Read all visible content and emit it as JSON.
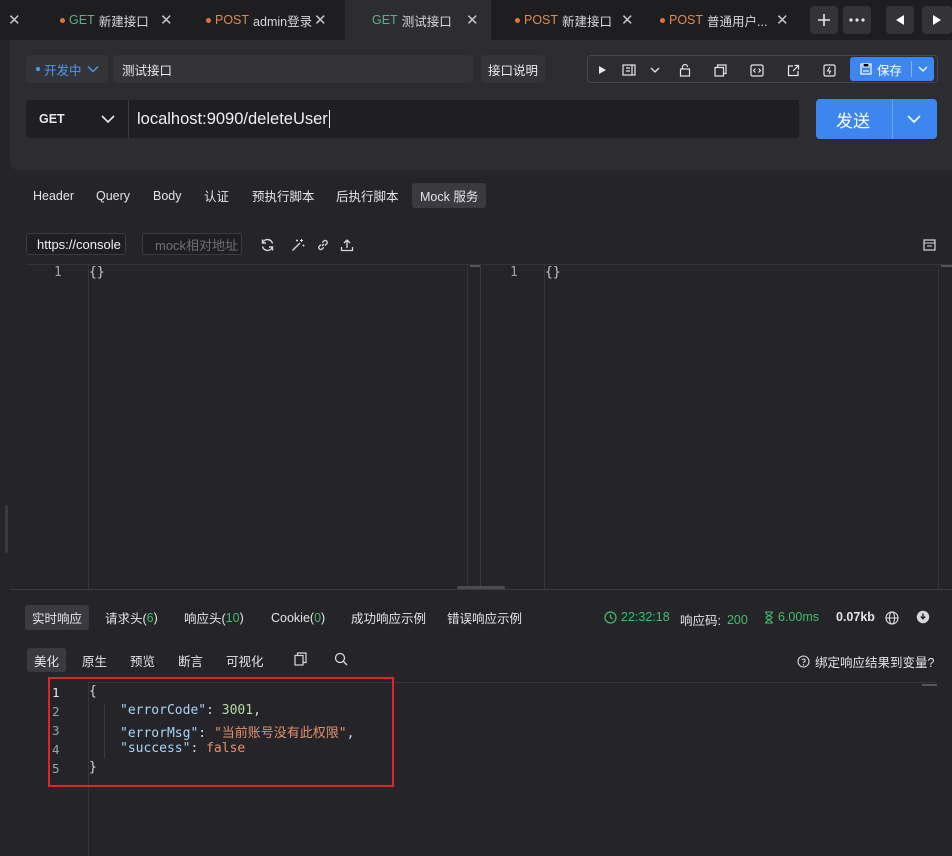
{
  "tabs": [
    {
      "method": "GET",
      "label": "新建接口",
      "dot": true
    },
    {
      "method": "POST",
      "label": "admin登录",
      "dot": true
    },
    {
      "method": "GET",
      "label": "测试接口",
      "dot": false,
      "active": true
    },
    {
      "method": "POST",
      "label": "新建接口",
      "dot": true
    },
    {
      "method": "POST",
      "label": "普通用户...",
      "dot": true
    }
  ],
  "header": {
    "status": "开发中",
    "api_name": "测试接口",
    "doc_button": "接口说明",
    "save_label": "保存"
  },
  "request": {
    "method": "GET",
    "url": "localhost:9090/deleteUser",
    "send_label": "发送"
  },
  "subtabs": [
    "Header",
    "Query",
    "Body",
    "认证",
    "预执行脚本",
    "后执行脚本",
    "Mock 服务"
  ],
  "mock": {
    "url_value": "https://console",
    "relative_placeholder": "mock相对地址",
    "left_editor": {
      "line_num": "1",
      "content": "{}"
    },
    "right_editor": {
      "line_num": "1",
      "content": "{}"
    }
  },
  "response_tabs": {
    "realtime": "实时响应",
    "req_headers": "请求头(",
    "req_headers_count": "6",
    "resp_headers": "响应头(",
    "resp_headers_count": "10",
    "cookie": "Cookie(",
    "cookie_count": "0",
    "close_paren": ")",
    "success_example": "成功响应示例",
    "error_example": "错误响应示例"
  },
  "response_meta": {
    "time": "22:32:18",
    "code_label": "响应码:",
    "code": "200",
    "duration": "6.00ms",
    "size": "0.07kb"
  },
  "view_tabs": [
    "美化",
    "原生",
    "预览",
    "断言",
    "可视化"
  ],
  "bind_hint": "绑定响应结果到变量?",
  "response_body": {
    "lines": [
      "1",
      "2",
      "3",
      "4",
      "5"
    ],
    "open": "{",
    "close": "}",
    "k1": "\"errorCode\"",
    "v1": "3001",
    "k2": "\"errorMsg\"",
    "v2": "\"当前账号没有此权限\"",
    "k3": "\"success\"",
    "v3": "false",
    "colon": ": ",
    "comma": ","
  },
  "colors": {
    "accent": "#3d86f0",
    "get": "#5fae8b",
    "post": "#e2884a",
    "success": "#3fbf6a",
    "highlight_box": "#e02424"
  }
}
